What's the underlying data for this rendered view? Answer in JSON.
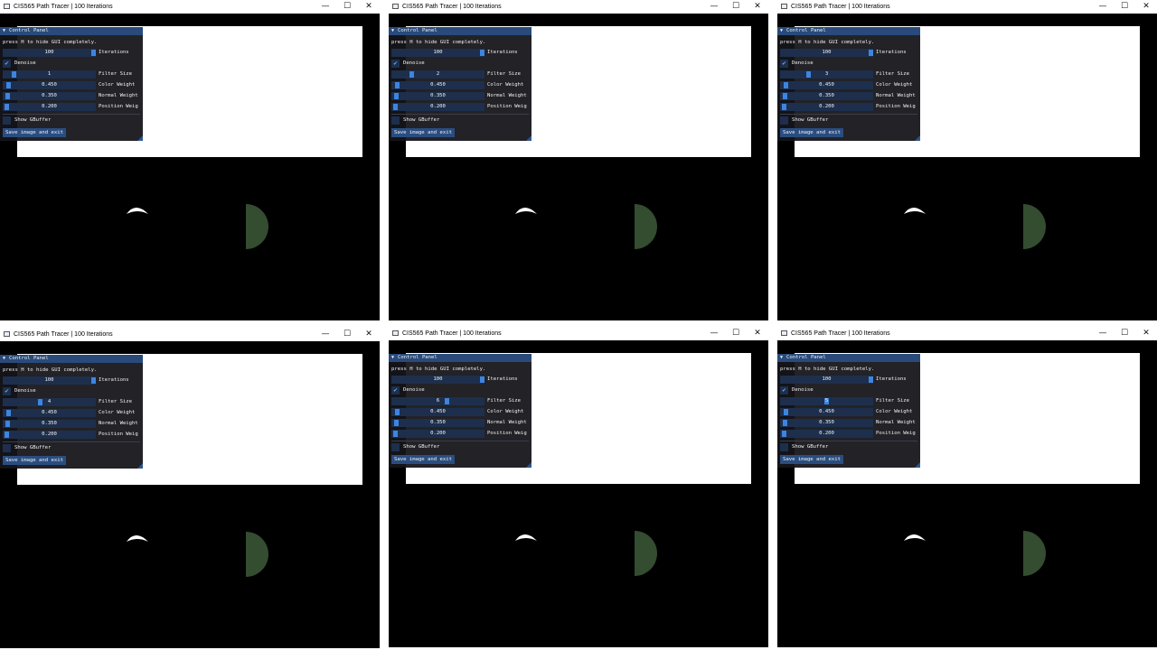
{
  "app": {
    "title": "CIS565 Path Tracer | 100 Iterations",
    "controls": {
      "minimize": "—",
      "maximize": "☐",
      "close": "✕"
    }
  },
  "gui": {
    "header": "Control Panel",
    "hint": "press H to hide GUI completely.",
    "iterations": {
      "value": "100",
      "label": "Iterations",
      "level": 1.0
    },
    "denoise": {
      "label": "Denoise",
      "checked": true
    },
    "filter_label": "Filter Size",
    "color_weight": {
      "value": "0.450",
      "label": "Color Weight"
    },
    "normal_weight": {
      "value": "0.350",
      "label": "Normal Weight"
    },
    "position_weight": {
      "value": "0.200",
      "label": "Position Weig"
    },
    "gbuffer": {
      "label": "Show GBuffer",
      "checked": false
    },
    "save_button": "Save image and exit"
  },
  "windows": [
    {
      "filter_size": "1",
      "filter_level": 0.1
    },
    {
      "filter_size": "2",
      "filter_level": 0.2
    },
    {
      "filter_size": "3",
      "filter_level": 0.3
    },
    {
      "filter_size": "4",
      "filter_level": 0.4
    },
    {
      "filter_size": "6",
      "filter_level": 0.6
    },
    {
      "filter_size": "5",
      "filter_level": 0.5
    }
  ],
  "colors": {
    "red_wall": "#8a2a24",
    "green_wall": "#2f7a2a",
    "back_wall": "#7a7a72",
    "panel_header": "#294a7a",
    "slider_grab": "#3d85e0"
  }
}
